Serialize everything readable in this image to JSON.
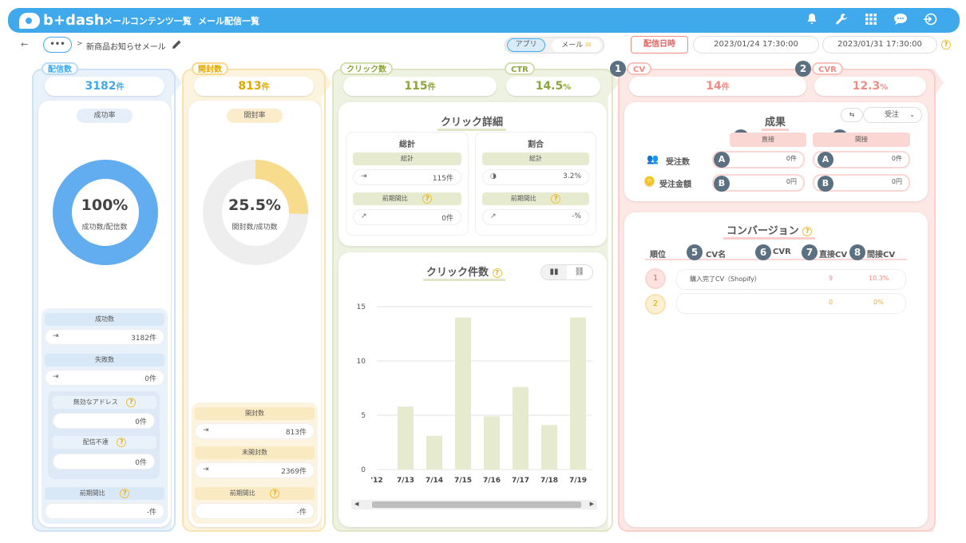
{
  "topbar": {
    "logo": "b+dash",
    "nav": [
      "メールコンテンツ一覧",
      "メール配信一覧"
    ],
    "icons": [
      "bell-icon",
      "wrench-icon",
      "grid-icon",
      "chat-icon",
      "logout-icon"
    ]
  },
  "breadcrumb": {
    "back": "←",
    "more": "•••",
    "sep": ">",
    "title": "新商品お知らせメール"
  },
  "filters": {
    "tab_app": "アプリ",
    "tab_mail": "メール",
    "delivery_date_label": "配信日時",
    "date_from": "2023/01/24 17:30:00",
    "date_sep": "~",
    "date_to": "2023/01/31 17:30:00"
  },
  "delivery": {
    "label": "配信数",
    "value": "3182",
    "unit": "件",
    "rate_label": "成功率",
    "donut_pct": 100,
    "donut_text": "100%",
    "donut_sub": "成功数/配信数",
    "success_label": "成功数",
    "success_value": "3182件",
    "fail_label": "失敗数",
    "fail_value": "0件",
    "invalid_label": "無効なアドレス",
    "invalid_value": "0件",
    "undeliv_label": "配信不達",
    "undeliv_value": "0件",
    "prev_label": "前期間比",
    "prev_value": "-件"
  },
  "open": {
    "label": "開封数",
    "value": "813",
    "unit": "件",
    "rate_label": "開封率",
    "donut_pct": 25.5,
    "donut_text": "25.5%",
    "donut_sub": "開封数/成功数",
    "opened_label": "開封数",
    "opened_value": "813件",
    "unopened_label": "未開封数",
    "unopened_value": "2369件",
    "prev_label": "前期間比",
    "prev_value": "-件"
  },
  "click": {
    "label": "クリック数",
    "value": "115",
    "unit": "件",
    "ctr_label": "CTR",
    "ctr_value": "14.5",
    "ctr_unit": "%",
    "detail_title": "クリック詳細",
    "total_title": "総計",
    "total_sub": "総計",
    "total_value": "115件",
    "total_prev_label": "前期間比",
    "total_prev_value": "0件",
    "ratio_title": "割合",
    "ratio_sub": "総計",
    "ratio_value": "3.2%",
    "ratio_prev_label": "前期間比",
    "ratio_prev_value": "-%",
    "chart_title": "クリック件数"
  },
  "cv": {
    "cv_label": "CV",
    "cv_value": "14",
    "cv_unit": "件",
    "cvr_label": "CVR",
    "cvr_value": "12.3",
    "cvr_unit": "%",
    "result_title": "成果",
    "select_value": "受注",
    "direct_label": "直接",
    "indirect_label": "間接",
    "orders_label": "受注数",
    "amount_label": "受注金額",
    "direct_orders": "0件",
    "direct_amount": "0円",
    "indirect_orders": "0件",
    "indirect_amount": "0円",
    "conv_title": "コンバージョン",
    "col_rank": "順位",
    "col_name": "CV名",
    "col_cvr": "CVR",
    "col_direct": "直接CV",
    "col_indirect": "間接CV",
    "rows": [
      {
        "rank": "1",
        "name": "購入完了CV（Shopify）",
        "cvr": "",
        "direct": "9",
        "indirect": "10.3%"
      },
      {
        "rank": "2",
        "name": "",
        "cvr": "",
        "direct": "0",
        "indirect": "0%"
      }
    ]
  },
  "badges": {
    "n1": "1",
    "n2": "2",
    "n3": "3",
    "n4": "4",
    "n5": "5",
    "n6": "6",
    "n7": "7",
    "n8": "8",
    "a": "A",
    "b": "B"
  },
  "colors": {
    "blue": "#3fa9ec",
    "yellow": "#f6c85a",
    "green": "#a9c46a",
    "pink": "#f28b82",
    "bar": "#e6ebcf"
  },
  "chart_data": {
    "type": "bar",
    "categories": [
      "7/12",
      "7/13",
      "7/14",
      "7/15",
      "7/16",
      "7/17",
      "7/18",
      "7/19"
    ],
    "values": [
      0,
      5.8,
      3.1,
      14,
      4.9,
      7.6,
      4.1,
      14
    ],
    "ylim": [
      0,
      15
    ],
    "yticks": [
      0,
      5,
      10,
      15
    ],
    "xtick_labels": [
      "'12",
      "7/13",
      "7/14",
      "7/15",
      "7/16",
      "7/17",
      "7/18",
      "7/19"
    ],
    "grid": true
  }
}
